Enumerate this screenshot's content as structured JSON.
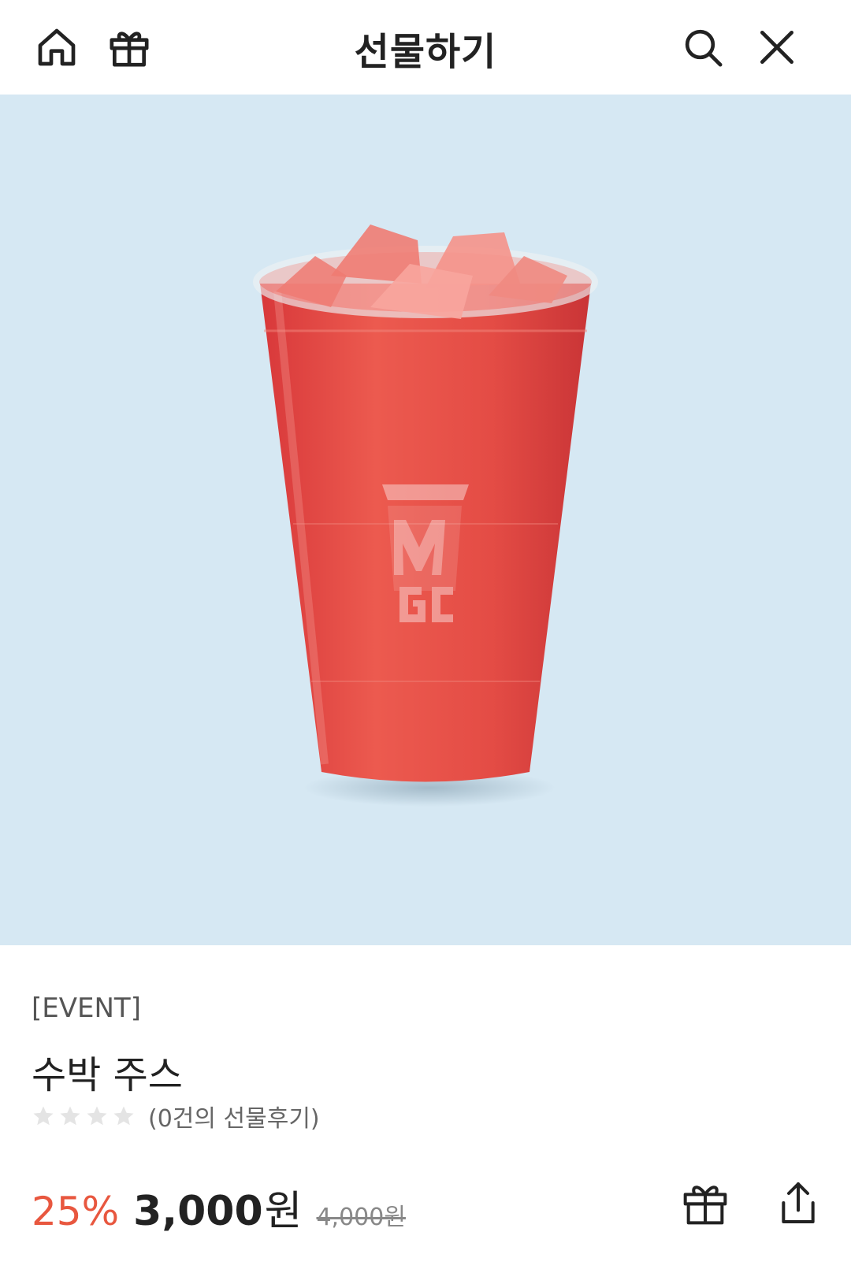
{
  "header": {
    "title": "선물하기",
    "icons": [
      "home-icon",
      "gift-icon",
      "search-icon",
      "close-icon"
    ]
  },
  "product": {
    "tag": "[EVENT]",
    "name": "수박 주스",
    "rating_stars": 0,
    "review_text": "(0건의 선물후기)",
    "discount": "25%",
    "price": "3,000",
    "price_unit": "원",
    "original_price": "4,000원"
  },
  "actions": {
    "icons": [
      "gift-icon",
      "share-icon"
    ]
  },
  "colors": {
    "accent": "#e8573f",
    "hero_bg": "#d6e8f3",
    "drink": "#e24a42"
  }
}
